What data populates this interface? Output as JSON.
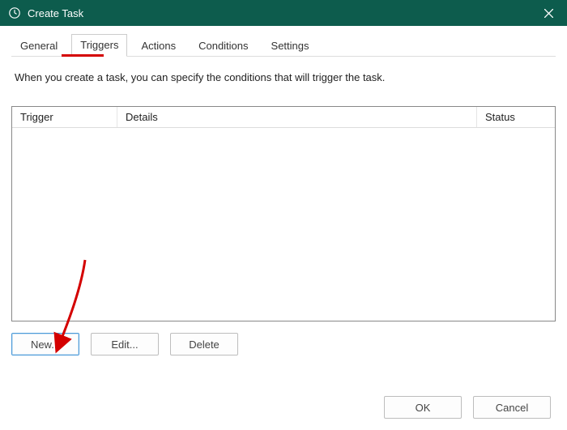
{
  "window": {
    "title": "Create Task",
    "icon": "clock-icon",
    "close_label": "Close"
  },
  "tabs": {
    "general": "General",
    "triggers": "Triggers",
    "actions": "Actions",
    "conditions": "Conditions",
    "settings": "Settings",
    "active": "triggers"
  },
  "description": "When you create a task, you can specify the conditions that will trigger the task.",
  "table": {
    "columns": {
      "trigger": "Trigger",
      "details": "Details",
      "status": "Status"
    },
    "rows": []
  },
  "buttons": {
    "new": "New...",
    "edit": "Edit...",
    "delete": "Delete",
    "ok": "OK",
    "cancel": "Cancel"
  },
  "annotation": {
    "underline_tab": "triggers",
    "arrow_target": "new-button"
  }
}
